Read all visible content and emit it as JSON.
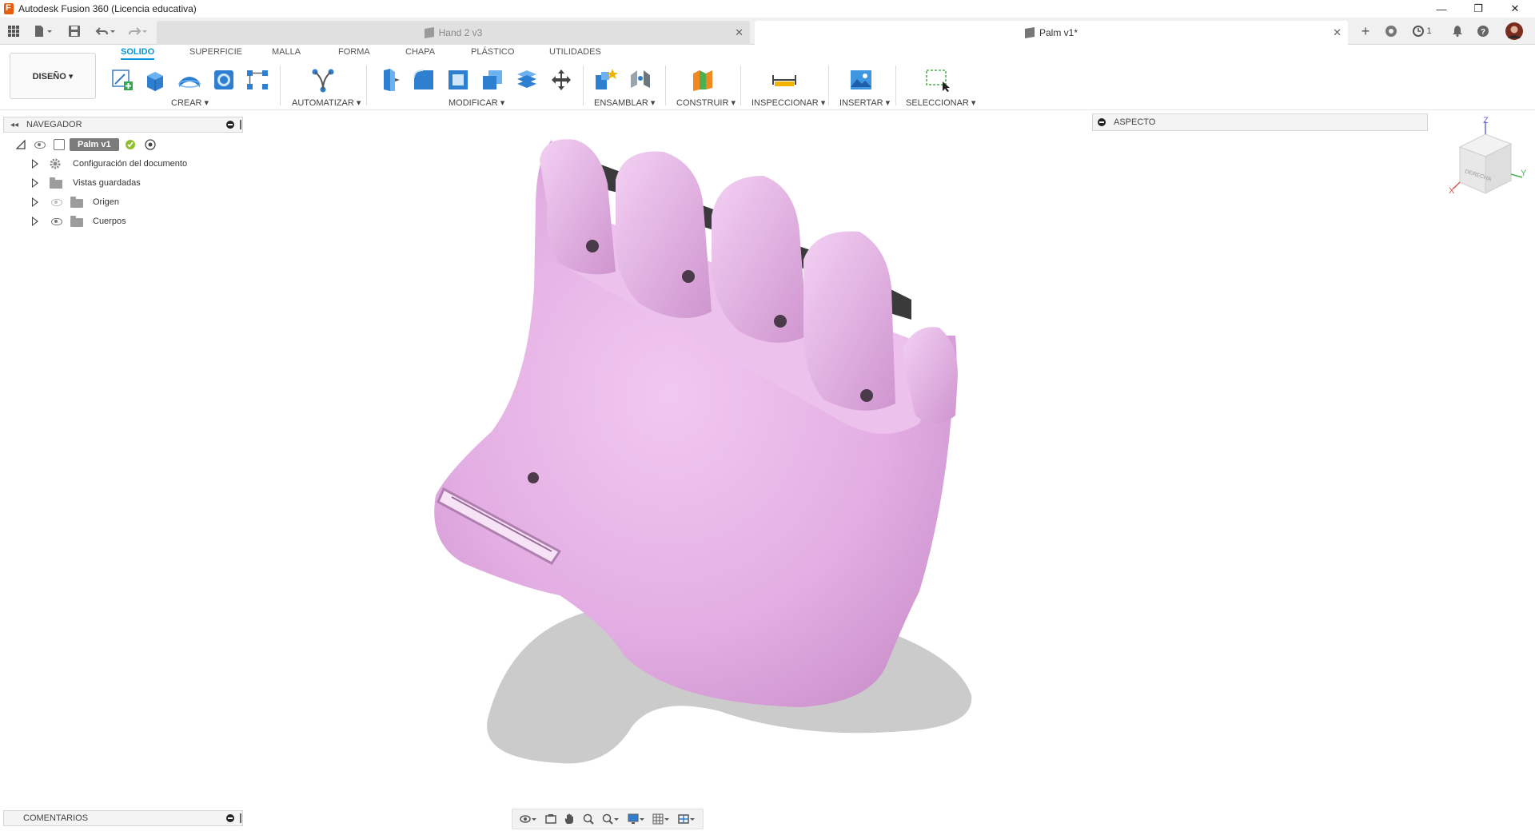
{
  "window": {
    "title": "Autodesk Fusion 360 (Licencia educativa)",
    "controls": [
      "—",
      "❐",
      "✕"
    ]
  },
  "quick_access": {
    "tabs": [
      {
        "label": "Hand 2 v3",
        "active": false
      },
      {
        "label": "Palm v1*",
        "active": true
      }
    ],
    "job_count": "1"
  },
  "toolbar": {
    "workspace_button": "DISEÑO ▾",
    "workspace_tabs": [
      "SOLIDO",
      "SUPERFICIE",
      "MALLA",
      "FORMA",
      "CHAPA",
      "PLÁSTICO",
      "UTILIDADES"
    ],
    "groups": [
      "CREAR ▾",
      "AUTOMATIZAR ▾",
      "MODIFICAR ▾",
      "ENSAMBLAR ▾",
      "CONSTRUIR ▾",
      "INSPECCIONAR ▾",
      "INSERTAR ▾",
      "SELECCIONAR ▾"
    ]
  },
  "browser": {
    "header": "NAVEGADOR",
    "root": "Palm v1",
    "items": [
      {
        "label": "Configuración del documento",
        "icon": "gear-icon"
      },
      {
        "label": "Vistas guardadas",
        "icon": "folder-icon"
      },
      {
        "label": "Origen",
        "icon": "folder-icon",
        "visible": false
      },
      {
        "label": "Cuerpos",
        "icon": "folder-icon",
        "visible": true
      }
    ]
  },
  "aspect_panel": {
    "label": "ASPECTO"
  },
  "comments_panel": {
    "label": "COMENTARIOS"
  },
  "viewcube": {
    "face": "DERECHA",
    "axes": [
      "Z",
      "Y",
      "X"
    ]
  },
  "colors": {
    "accent": "#0696d7",
    "model": "#e3aee3",
    "shadow": "#c8c8c8"
  }
}
